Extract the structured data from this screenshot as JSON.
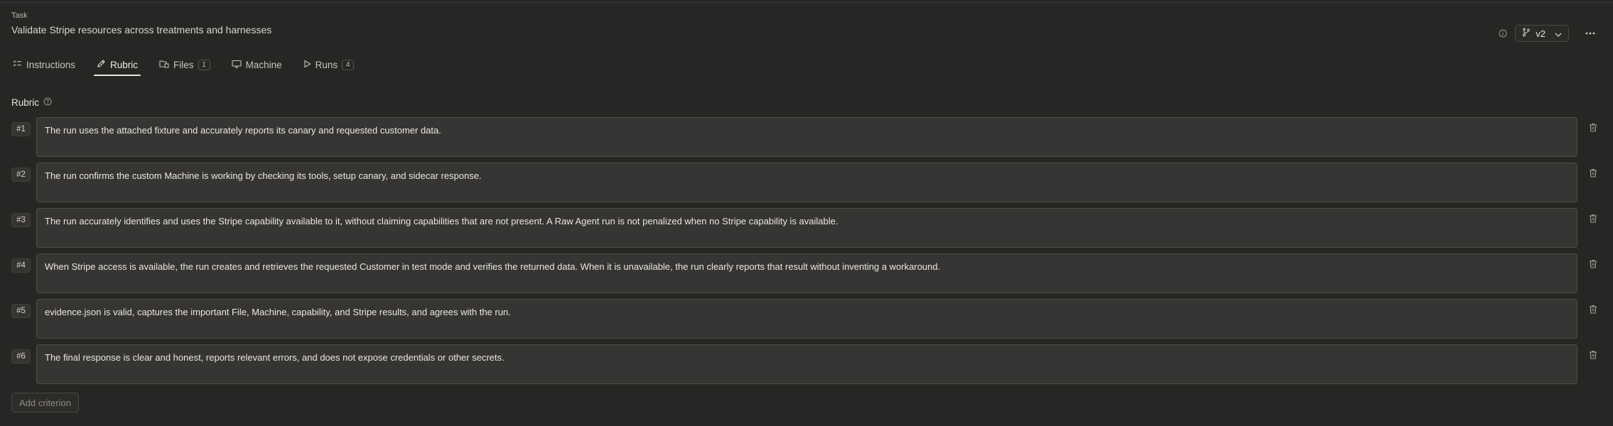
{
  "header": {
    "task_label": "Task",
    "task_title": "Validate Stripe resources across treatments and harnesses",
    "version": "v2"
  },
  "tabs": [
    {
      "label": "Instructions",
      "icon": "list-check-icon"
    },
    {
      "label": "Rubric",
      "icon": "pencil-icon",
      "active": true
    },
    {
      "label": "Files",
      "icon": "files-icon",
      "badge": "1"
    },
    {
      "label": "Machine",
      "icon": "monitor-icon"
    },
    {
      "label": "Runs",
      "icon": "play-icon",
      "badge": "4"
    }
  ],
  "rubric": {
    "title": "Rubric",
    "criteria": [
      {
        "num": "#1",
        "text": "The run uses the attached fixture and accurately reports its canary and requested customer data."
      },
      {
        "num": "#2",
        "text": "The run confirms the custom Machine is working by checking its tools, setup canary, and sidecar response."
      },
      {
        "num": "#3",
        "text": "The run accurately identifies and uses the Stripe capability available to it, without claiming capabilities that are not present. A Raw Agent run is not penalized when no Stripe capability is available."
      },
      {
        "num": "#4",
        "text": "When Stripe access is available, the run creates and retrieves the requested Customer in test mode and verifies the returned data. When it is unavailable, the run clearly reports that result without inventing a workaround."
      },
      {
        "num": "#5",
        "text": "evidence.json is valid, captures the important File, Machine, capability, and Stripe results, and agrees with the run."
      },
      {
        "num": "#6",
        "text": "The final response is clear and honest, reports relevant errors, and does not expose credentials or other secrets."
      }
    ],
    "add_label": "Add criterion"
  },
  "colors": {
    "background": "#262624",
    "field_background": "#363533",
    "field_border": "#4e4d49",
    "text": "#ebe8e0"
  }
}
